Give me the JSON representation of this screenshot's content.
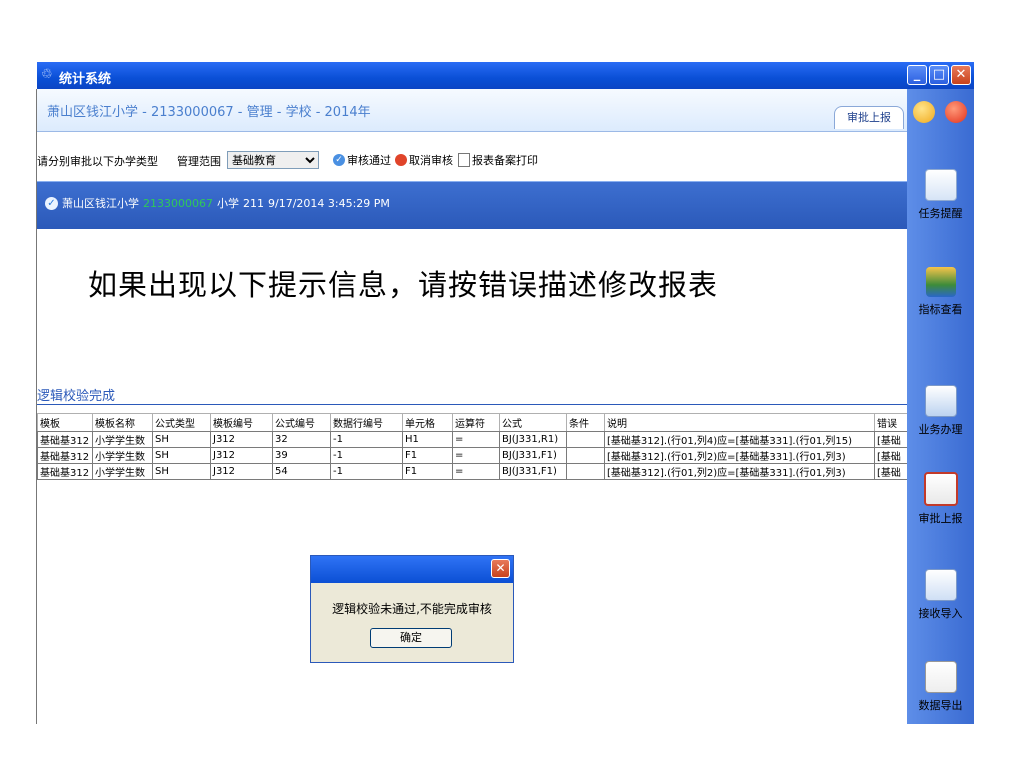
{
  "window": {
    "title": "统计系统"
  },
  "header": {
    "context": "萧山区钱江小学 - 2133000067 - 管理 - 学校 - 2014年",
    "approve_tab": "审批上报"
  },
  "toolbar": {
    "prompt": "请分别审批以下办学类型",
    "scope_label": "管理范围",
    "scope_value": "基础教育",
    "approve": "审核通过",
    "cancel": "取消审核",
    "print": "报表备案打印"
  },
  "infobar": {
    "school": "萧山区钱江小学",
    "code": "2133000067",
    "type": "小学",
    "num": "211",
    "datetime": "9/17/2014 3:45:29 PM"
  },
  "banner": "如果出现以下提示信息，请按错误描述修改报表",
  "logic_title": "逻辑校验完成",
  "table": {
    "headers": [
      "模板",
      "模板名称",
      "公式类型",
      "模板编号",
      "公式编号",
      "数据行编号",
      "单元格",
      "运算符",
      "公式",
      "条件",
      "说明",
      "错误"
    ],
    "rows": [
      [
        "基础基312",
        "小学学生数",
        "SH",
        "J312",
        "32",
        "-1",
        "H1",
        "=",
        "BJ(J331,R1)",
        "",
        "[基础基312].(行01,列4)应=[基础基331].(行01,列15)",
        "[基础"
      ],
      [
        "基础基312",
        "小学学生数",
        "SH",
        "J312",
        "39",
        "-1",
        "F1",
        "=",
        "BJ(J331,F1)",
        "",
        "[基础基312].(行01,列2)应=[基础基331].(行01,列3)",
        "[基础"
      ],
      [
        "基础基312",
        "小学学生数",
        "SH",
        "J312",
        "54",
        "-1",
        "F1",
        "=",
        "BJ(J331,F1)",
        "",
        "[基础基312].(行01,列2)应=[基础基331].(行01,列3)",
        "[基础"
      ]
    ]
  },
  "sidebar": {
    "items": [
      {
        "label": "任务提醒",
        "icon": "calendar-clock-icon"
      },
      {
        "label": "指标查看",
        "icon": "books-icon"
      },
      {
        "label": "业务办理",
        "icon": "documents-icon"
      },
      {
        "label": "审批上报",
        "icon": "clipboard-check-icon"
      },
      {
        "label": "接收导入",
        "icon": "paper-receive-icon"
      },
      {
        "label": "数据导出",
        "icon": "document-export-icon"
      }
    ]
  },
  "dialog": {
    "message": "逻辑校验未通过,不能完成审核",
    "ok": "确定"
  },
  "colors": {
    "titlebar": "#0a4fd6",
    "accent": "#2b59b9",
    "code_green": "#2fc85a"
  }
}
